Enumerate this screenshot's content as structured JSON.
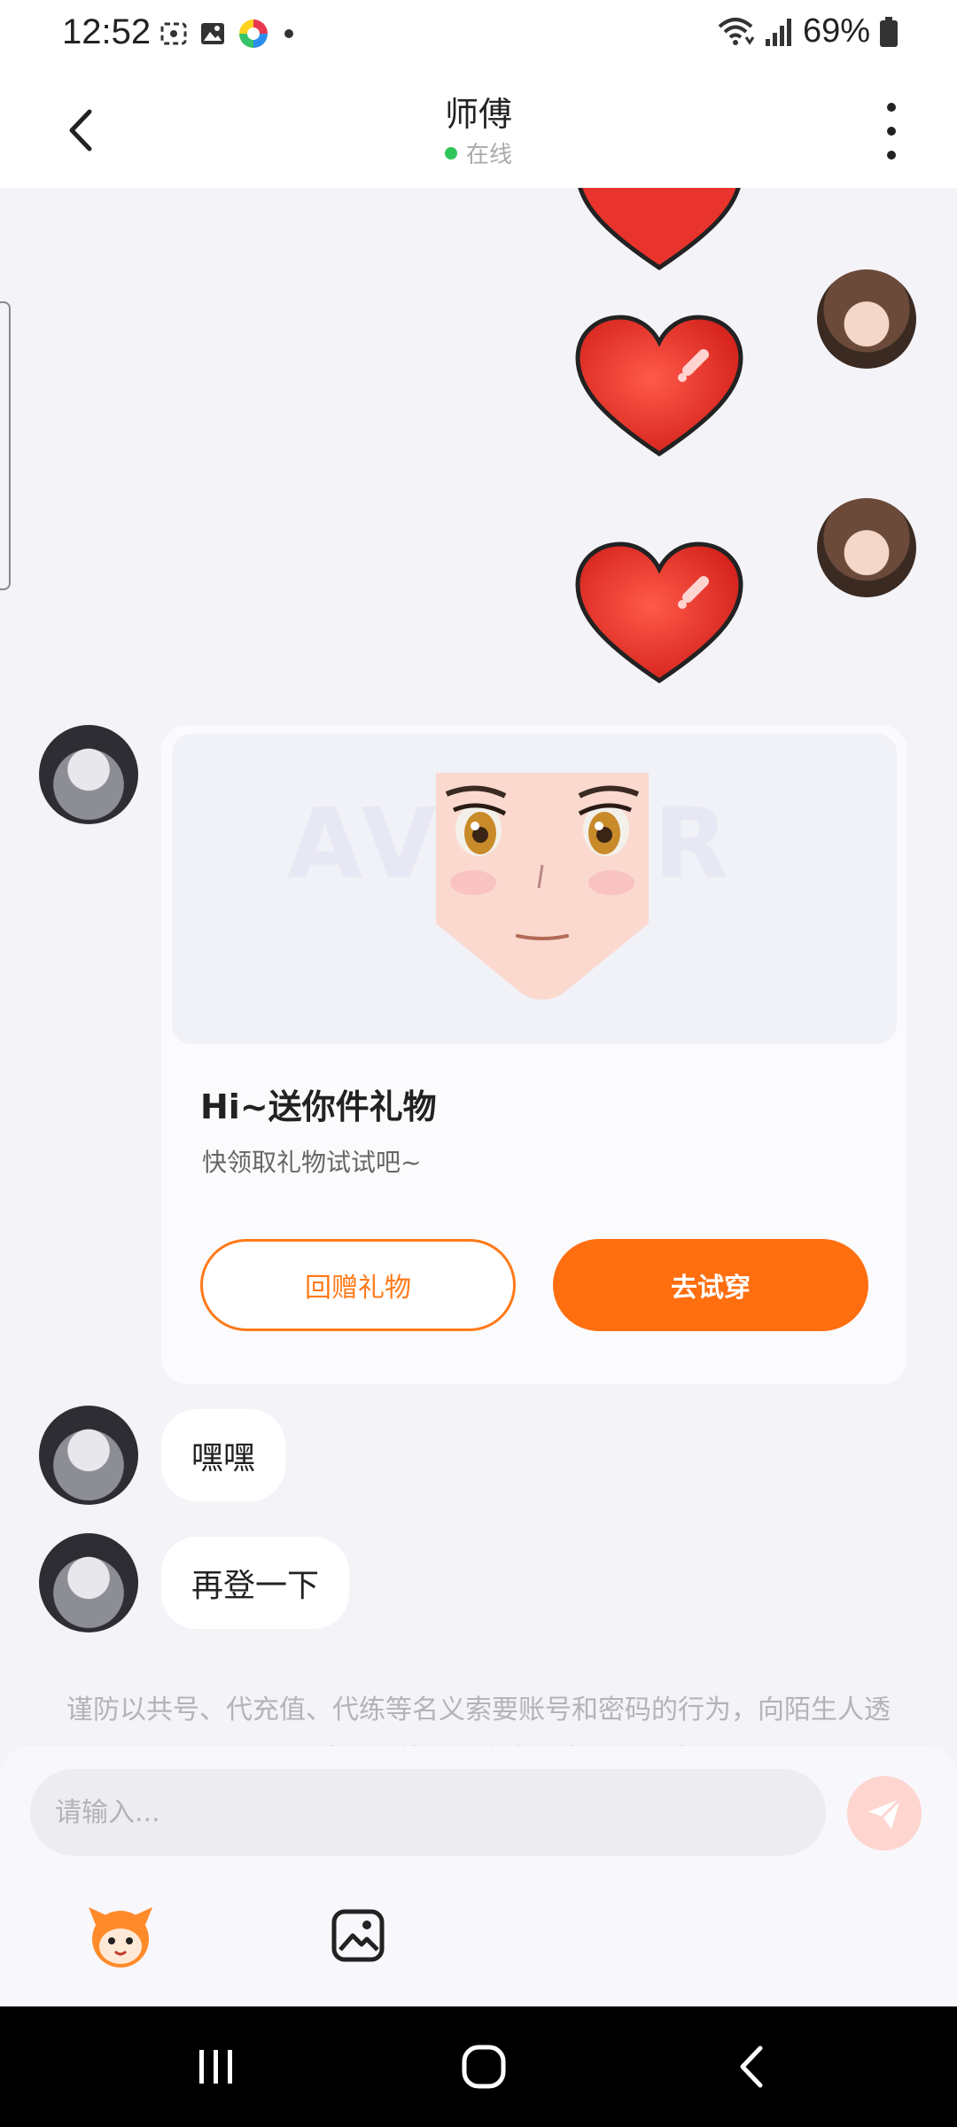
{
  "status_bar": {
    "time": "12:52",
    "battery_percent": "69%",
    "icons_left": [
      "screenshot-icon",
      "gallery-icon",
      "color-app-icon",
      "dot-icon"
    ],
    "icons_right": [
      "wifi-icon",
      "signal-icon",
      "battery-icon"
    ]
  },
  "header": {
    "title": "师傅",
    "status": "在线",
    "status_color": "#2ec55b"
  },
  "messages": [
    {
      "type": "gift-sticker",
      "from": "me",
      "sticker": "heart"
    },
    {
      "type": "gift-sticker",
      "from": "me",
      "sticker": "heart"
    },
    {
      "type": "gift-card",
      "from": "other",
      "watermark": "AVATAR",
      "title": "Hi~送你件礼物",
      "subtitle": "快领取礼物试试吧~",
      "secondary_button": "回赠礼物",
      "primary_button": "去试穿"
    },
    {
      "type": "text",
      "from": "other",
      "text": "嘿嘿"
    },
    {
      "type": "text",
      "from": "other",
      "text": "再登一下"
    }
  ],
  "notice": "谨防以共号、代充值、代练等名义索要账号和密码的行为，向陌生人透露账号密码可能导致资产丢失，账号被盗",
  "input": {
    "placeholder": "请输入..."
  },
  "toolbar": {
    "emoji_icon": "mascot-emoji-icon",
    "image_icon": "image-icon"
  },
  "colors": {
    "accent": "#ff6e0f",
    "background": "#f4f3f8",
    "send_button": "#ffd5cf"
  }
}
